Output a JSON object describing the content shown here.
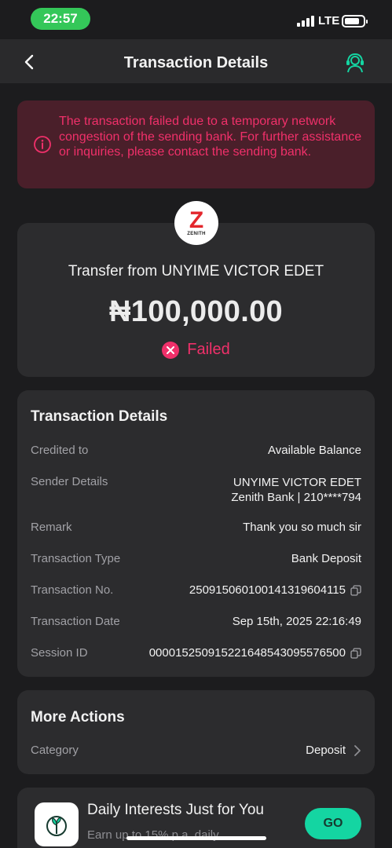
{
  "status_bar": {
    "time": "22:57",
    "network": "LTE",
    "time_pill_color": "#34c759"
  },
  "header": {
    "title": "Transaction Details",
    "back_icon": "chevron-left-icon",
    "support_icon": "customer-support-icon"
  },
  "error_banner": {
    "message": "The transaction failed due to a temporary network congestion of the sending bank. For further assistance or inquiries, please contact the sending bank.",
    "icon": "info-circle-icon",
    "color": "#f0306a"
  },
  "summary": {
    "bank_logo_letter": "Z",
    "bank_logo_name": "ZENITH",
    "transfer_from": "Transfer from UNYIME VICTOR EDET",
    "amount": "₦100,000.00",
    "status": "Failed",
    "status_icon": "close-circle-icon"
  },
  "details": {
    "heading": "Transaction Details",
    "rows": [
      {
        "label": "Credited to",
        "value": "Available Balance"
      },
      {
        "label": "Sender Details",
        "value": "UNYIME VICTOR EDET",
        "value2": "Zenith Bank | 210****794"
      },
      {
        "label": "Remark",
        "value": "Thank you so much sir"
      },
      {
        "label": "Transaction Type",
        "value": "Bank Deposit"
      },
      {
        "label": "Transaction No.",
        "value": "250915060100141319604115"
      },
      {
        "label": "Transaction Date",
        "value": "Sep 15th, 2025 22:16:49"
      },
      {
        "label": "Session ID",
        "value": "000015250915221648543095576500"
      }
    ]
  },
  "more_actions": {
    "heading": "More Actions",
    "category_label": "Category",
    "category_value": "Deposit"
  },
  "promo": {
    "title": "Daily Interests Just for You",
    "subtitle": "Earn up to 15% p.a. daily",
    "button": "GO",
    "accent": "#14d5a2"
  }
}
